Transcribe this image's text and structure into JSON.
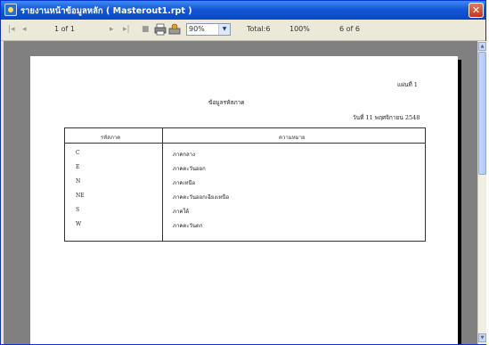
{
  "window": {
    "title": "รายงานหน้าข้อมูลหลัก ( Masterout1.rpt )",
    "close_glyph": "✕"
  },
  "toolbar": {
    "nav_first": "|◂",
    "nav_prev": "◂",
    "page_indicator": "1 of 1",
    "nav_next": "▸",
    "nav_last": "▸|",
    "stop": "■",
    "zoom_value": "90%",
    "zoom_arrow": "▼",
    "total_label": "Total:6",
    "percent_label": "100%",
    "records_label": "6 of 6"
  },
  "report": {
    "page_number": "แผ่นที่   1",
    "title": "ข้อมูลรหัสภาค",
    "date_line": "วันที่ 11 พฤศจิกายน 2548",
    "headers": {
      "code": "รหัสภาค",
      "description": "ความหมาย"
    },
    "rows": [
      {
        "code": "C",
        "description": "ภาคกลาง"
      },
      {
        "code": "E",
        "description": "ภาคตะวันออก"
      },
      {
        "code": "N",
        "description": "ภาคเหนือ"
      },
      {
        "code": "NE",
        "description": "ภาคตะวันออกเฉียงเหนือ"
      },
      {
        "code": "S",
        "description": "ภาคใต้"
      },
      {
        "code": "W",
        "description": "ภาคตะวันตก"
      }
    ]
  },
  "scrollbar": {
    "up_glyph": "▲",
    "down_glyph": "▼"
  },
  "colors": {
    "titlebar": "#1458d8",
    "viewport_bg": "#808080",
    "window_bg": "#ece9d8"
  }
}
